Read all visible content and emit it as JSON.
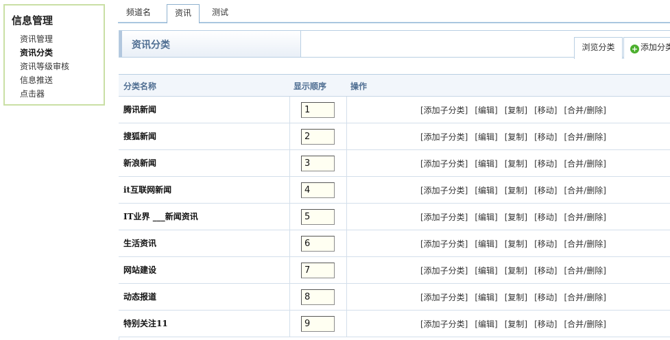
{
  "sidebar": {
    "title": "信息管理",
    "items": [
      {
        "label": "资讯管理",
        "active": false
      },
      {
        "label": "资讯分类",
        "active": true
      },
      {
        "label": "资讯等级审核",
        "active": false
      },
      {
        "label": "信息推送",
        "active": false
      },
      {
        "label": "点击器",
        "active": false
      }
    ]
  },
  "top_tabs": [
    {
      "label": "频道名",
      "active": false
    },
    {
      "label": "资讯",
      "active": true
    },
    {
      "label": "测试",
      "active": false
    }
  ],
  "header": {
    "title": "资讯分类",
    "browse_label": "浏览分类",
    "add_label": "添加分类"
  },
  "table": {
    "columns": [
      "分类名称",
      "显示顺序",
      "操作"
    ],
    "actions": [
      "[添加子分类]",
      "[编辑]",
      "[复制]",
      "[移动]",
      "[合并/删除]"
    ],
    "rows": [
      {
        "name": "腾讯新闻",
        "order": "1"
      },
      {
        "name": "搜狐新闻",
        "order": "2"
      },
      {
        "name": "新浪新闻",
        "order": "3"
      },
      {
        "name": "it互联网新闻",
        "order": "4"
      },
      {
        "name": "IT业界 ___新闻资讯",
        "order": "5"
      },
      {
        "name": "生活资讯",
        "order": "6"
      },
      {
        "name": "网站建设",
        "order": "7"
      },
      {
        "name": "动态报道",
        "order": "8"
      },
      {
        "name": "特别关注11",
        "order": "9"
      }
    ]
  },
  "colors": {
    "accent": "#4f6e92",
    "sidebar_border": "#c9dfa4",
    "table_border": "#d3dfeb",
    "input_bg": "#fffff2"
  }
}
